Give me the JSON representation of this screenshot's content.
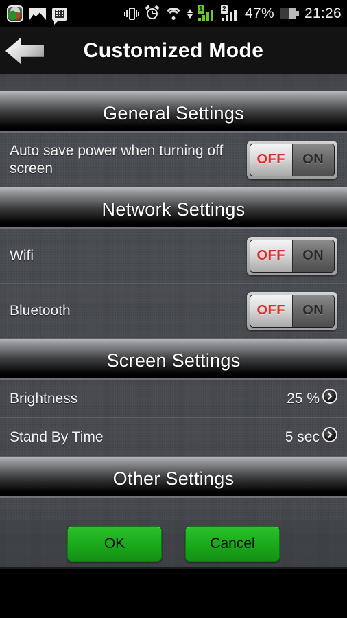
{
  "status_bar": {
    "left_icons": [
      "app-icon",
      "gallery-icon",
      "bbm-icon"
    ],
    "right_icons": [
      "vibrate-icon",
      "alarm-icon",
      "wifi-icon",
      "updown-arrows-icon"
    ],
    "sim1_label": "1",
    "sim2_label": "2",
    "battery_percent": "47%",
    "battery_level": 47,
    "time": "21:26"
  },
  "title_bar": {
    "back_icon": "back-arrow-icon",
    "title": "Customized Mode"
  },
  "sections": [
    {
      "header": "General Settings",
      "rows": [
        {
          "name": "Auto save power when turning off screen",
          "type": "toggle",
          "off_label": "OFF",
          "on_label": "ON",
          "state": "OFF"
        }
      ]
    },
    {
      "header": "Network Settings",
      "rows": [
        {
          "name": "Wifi",
          "type": "toggle",
          "off_label": "OFF",
          "on_label": "ON",
          "state": "OFF"
        },
        {
          "name": "Bluetooth",
          "type": "toggle",
          "off_label": "OFF",
          "on_label": "ON",
          "state": "OFF"
        }
      ]
    },
    {
      "header": "Screen Settings",
      "rows": [
        {
          "name": "Brightness",
          "type": "value",
          "value": "25 %",
          "chevron": "chevron-right-icon"
        },
        {
          "name": "Stand By Time",
          "type": "value",
          "value": "5 sec",
          "chevron": "chevron-right-icon"
        }
      ]
    },
    {
      "header": "Other Settings",
      "rows": []
    }
  ],
  "buttons": {
    "ok_label": "OK",
    "cancel_label": "Cancel",
    "accent_green": "#1aa81a"
  }
}
